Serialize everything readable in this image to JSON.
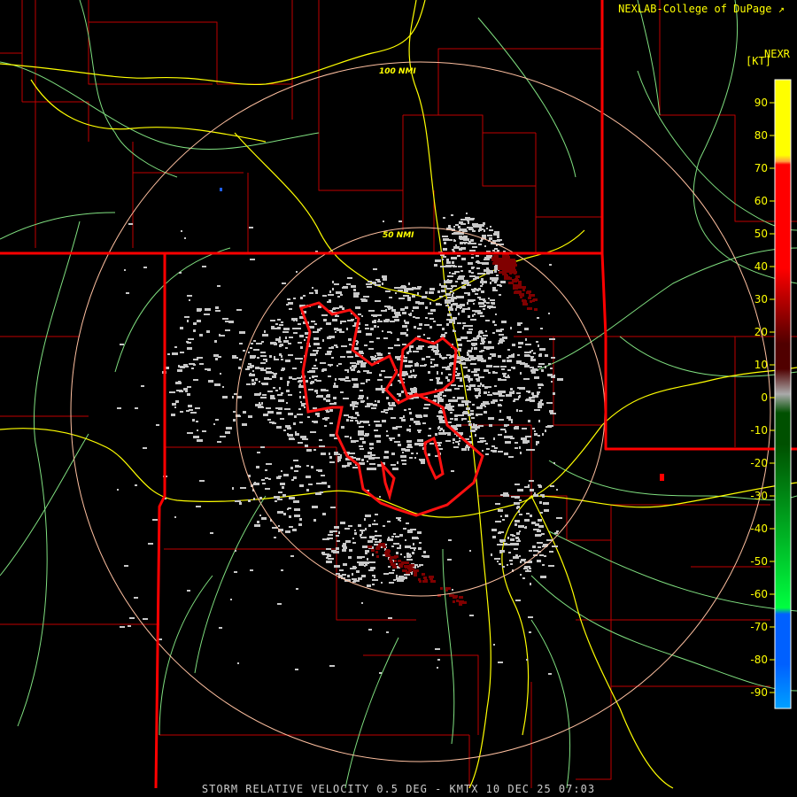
{
  "header": {
    "credit": "NEXLAB-College of DuPage",
    "product": "NEXR",
    "unit": "[KT]"
  },
  "footer": {
    "caption": "STORM RELATIVE VELOCITY 0.5 DEG - KMTX 10 DEC 25 07:03"
  },
  "range_rings": [
    {
      "label": "50 NMI"
    },
    {
      "label": "100 NMI"
    }
  ],
  "legend": {
    "ticks": [
      90,
      80,
      70,
      60,
      50,
      40,
      30,
      20,
      10,
      0,
      -10,
      -20,
      -30,
      -40,
      -50,
      -60,
      -70,
      -80,
      -90
    ],
    "colors": {
      "top": "#ffff00",
      "orange": "#ffa040",
      "red": "#ff0000",
      "dark_red": "#500000",
      "gray": "#aaaaaa",
      "dark_green": "#005000",
      "green": "#00ff40",
      "blue": "#0060ff",
      "light_blue": "#00a0ff"
    }
  },
  "map_colors": {
    "state_border": "#ff0000",
    "county_border": "#c00000",
    "highway": "#ffff00",
    "road": "#80e080",
    "ring": "#ffc0a0",
    "warning_polygon": "#ff1010",
    "echo_gray": "#c8c8c8",
    "echo_red": "#800000"
  }
}
